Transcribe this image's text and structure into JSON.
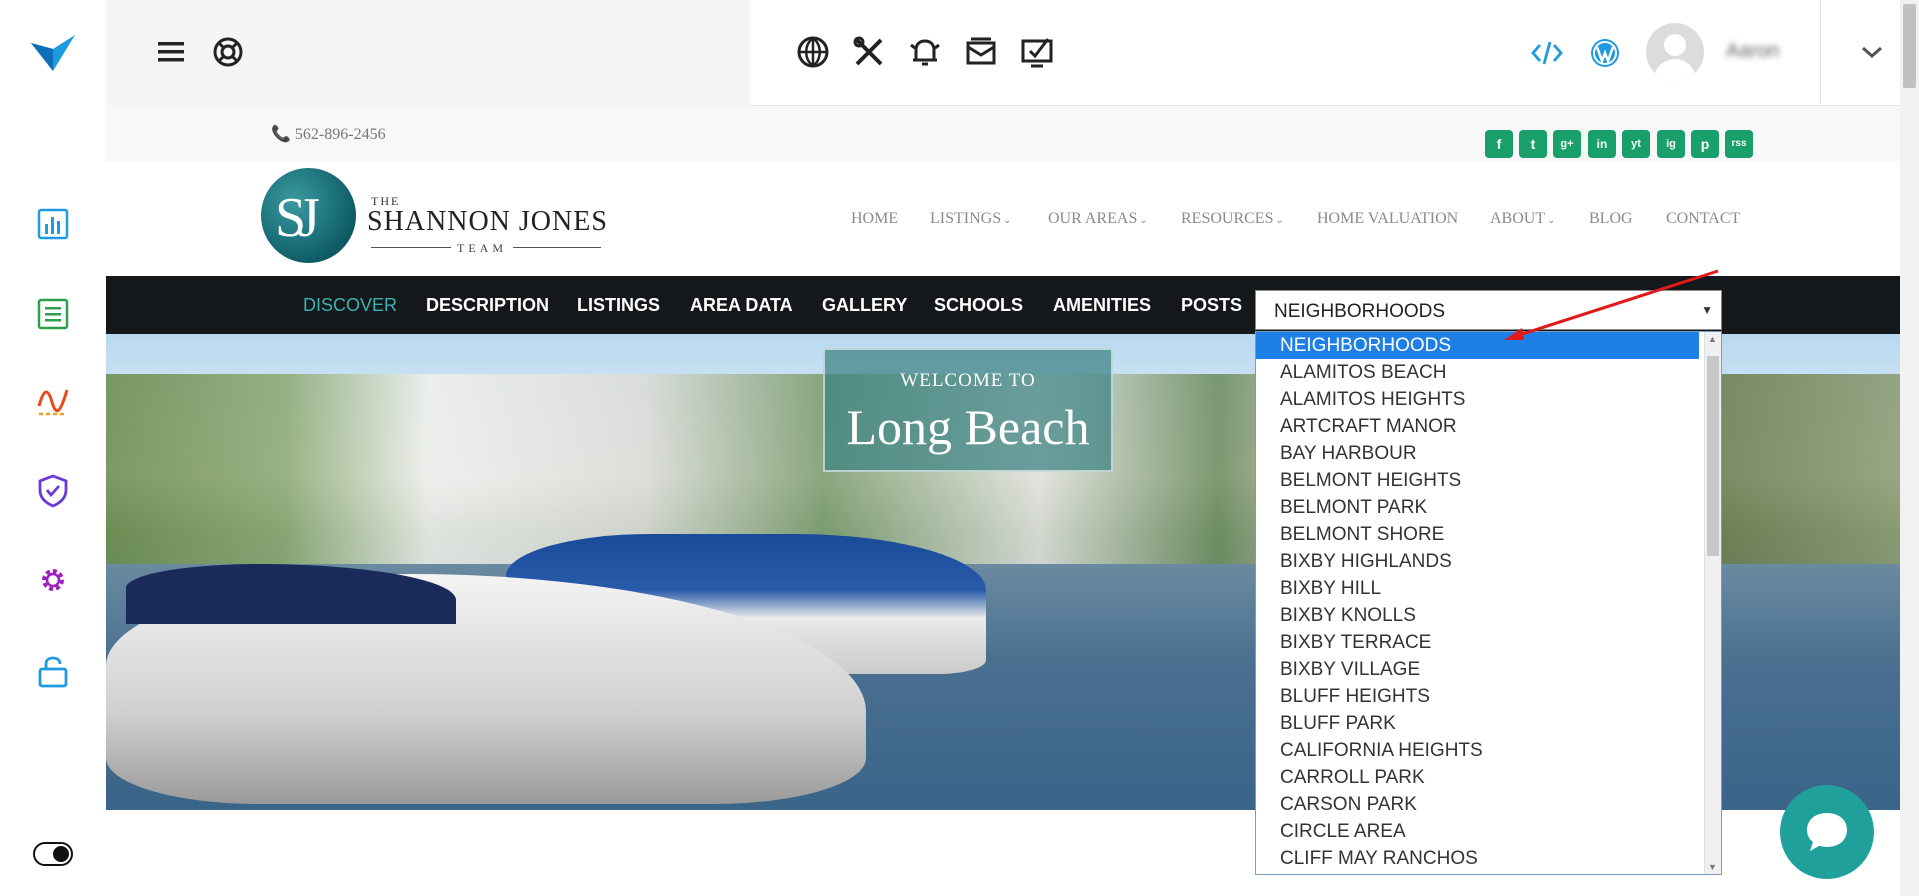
{
  "rail": {
    "icons": [
      "analytics-icon",
      "list-icon",
      "chart-line-icon",
      "shield-icon",
      "gear-icon",
      "lock-icon"
    ]
  },
  "topbar": {
    "username": "Aaron"
  },
  "site": {
    "phone": "📞 562-896-2456",
    "social": [
      "f",
      "t",
      "g+",
      "in",
      "yt",
      "ig",
      "p",
      "rss"
    ],
    "brand": {
      "sj": "SJ",
      "the": "THE",
      "name": "SHANNON JONES",
      "team": "TEAM"
    },
    "mainnav": [
      {
        "label": "HOME",
        "chevron": ""
      },
      {
        "label": "LISTINGS",
        "chevron": "⌄"
      },
      {
        "label": "OUR AREAS",
        "chevron": "⌄"
      },
      {
        "label": "RESOURCES",
        "chevron": "⌄"
      },
      {
        "label": "HOME VALUATION",
        "chevron": ""
      },
      {
        "label": "ABOUT",
        "chevron": "⌄"
      },
      {
        "label": "BLOG",
        "chevron": ""
      },
      {
        "label": "CONTACT",
        "chevron": ""
      }
    ],
    "subnav": [
      "DISCOVER",
      "DESCRIPTION",
      "LISTINGS",
      "AREA DATA",
      "GALLERY",
      "SCHOOLS",
      "AMENITIES",
      "POSTS"
    ],
    "hero": {
      "welcome": "WELCOME TO",
      "city": "Long Beach"
    },
    "select": {
      "value": "NEIGHBORHOODS",
      "options": [
        "NEIGHBORHOODS",
        "ALAMITOS BEACH",
        "ALAMITOS HEIGHTS",
        "ARTCRAFT MANOR",
        "BAY HARBOUR",
        "BELMONT HEIGHTS",
        "BELMONT PARK",
        "BELMONT SHORE",
        "BIXBY HIGHLANDS",
        "BIXBY HILL",
        "BIXBY KNOLLS",
        "BIXBY TERRACE",
        "BIXBY VILLAGE",
        "BLUFF HEIGHTS",
        "BLUFF PARK",
        "CALIFORNIA HEIGHTS",
        "CARROLL PARK",
        "CARSON PARK",
        "CIRCLE AREA",
        "CLIFF MAY RANCHOS"
      ]
    }
  }
}
